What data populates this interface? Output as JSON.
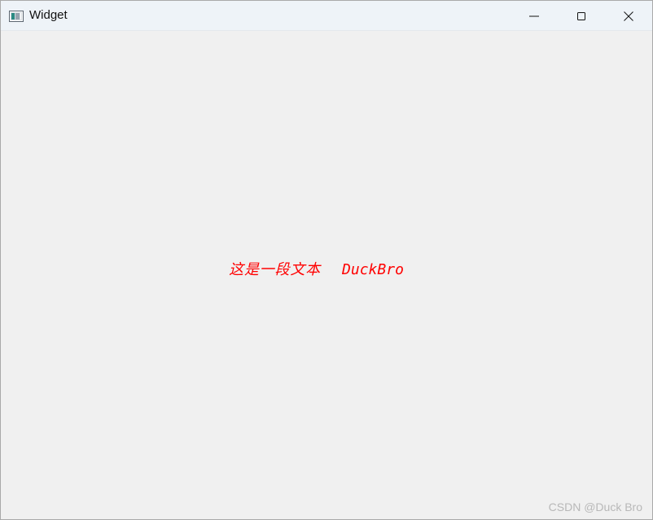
{
  "window": {
    "title": "Widget",
    "buttons": {
      "minimize_icon": "minimize-icon",
      "maximize_icon": "maximize-icon",
      "close_icon": "close-icon"
    }
  },
  "content": {
    "label_text_cn": "这是一段文本",
    "label_text_en": "DuckBro",
    "text_color": "#ff0000"
  },
  "watermark": {
    "text": "CSDN @Duck Bro"
  }
}
